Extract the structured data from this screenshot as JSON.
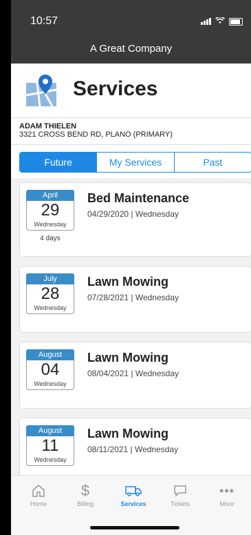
{
  "status": {
    "time": "10:57"
  },
  "app": {
    "title": "A Great Company"
  },
  "page": {
    "title": "Services"
  },
  "customer": {
    "name": "ADAM THIELEN",
    "address": "3321 CROSS BEND RD, PLANO (PRIMARY)"
  },
  "tabs": [
    {
      "label": "Future",
      "active": true
    },
    {
      "label": "My Services",
      "active": false
    },
    {
      "label": "Past",
      "active": false
    }
  ],
  "services": [
    {
      "month": "April",
      "day": "29",
      "weekday": "Wednesday",
      "away": "4 days",
      "title": "Bed Maintenance",
      "date": "04/29/2020 | Wednesday"
    },
    {
      "month": "July",
      "day": "28",
      "weekday": "Wednesday",
      "away": "",
      "title": "Lawn Mowing",
      "date": "07/28/2021 | Wednesday"
    },
    {
      "month": "August",
      "day": "04",
      "weekday": "Wednesday",
      "away": "",
      "title": "Lawn Mowing",
      "date": "08/04/2021 | Wednesday"
    },
    {
      "month": "August",
      "day": "11",
      "weekday": "Wednesday",
      "away": "",
      "title": "Lawn Mowing",
      "date": "08/11/2021 | Wednesday"
    }
  ],
  "tabbar": [
    {
      "label": "Home",
      "icon": "home-icon"
    },
    {
      "label": "Billing",
      "icon": "dollar-icon"
    },
    {
      "label": "Services",
      "icon": "truck-icon"
    },
    {
      "label": "Tickets",
      "icon": "chat-icon"
    },
    {
      "label": "More",
      "icon": "more-icon"
    }
  ],
  "colors": {
    "accent": "#1e88e5",
    "header": "#3a3a3a",
    "calendar": "#3a8cc9"
  }
}
